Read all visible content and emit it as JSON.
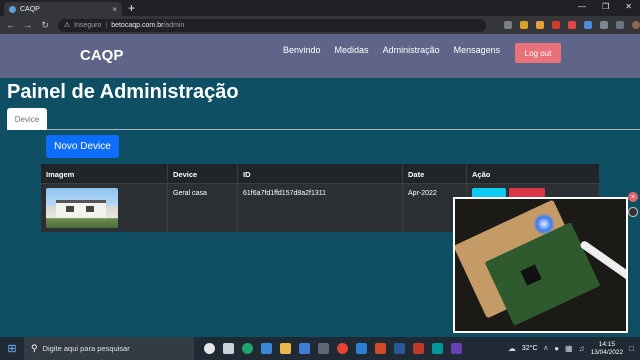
{
  "browser": {
    "tab_title": "CAQP",
    "tab_close": "×",
    "new_tab": "+",
    "win_min": "—",
    "win_restore": "❐",
    "win_close": "✕",
    "security_label": "Inseguro",
    "url_host": "betocaqp.com.br",
    "url_path": "/admin"
  },
  "navbar": {
    "brand": "CAQP",
    "links": [
      "Benvindo",
      "Medidas",
      "Administração",
      "Mensagens"
    ],
    "logout_label": "Log out"
  },
  "page": {
    "title": "Painel de Administração",
    "tab_label": "Device",
    "new_button": "Novo Device"
  },
  "table": {
    "headers": [
      "Imagem",
      "Device",
      "ID",
      "Date",
      "Ação"
    ],
    "rows": [
      {
        "device": "Geral casa",
        "id": "61f6a7fd1ffd157d8a2f1311",
        "date": "Apr-2022"
      }
    ]
  },
  "taskbar": {
    "search_placeholder": "Digite aqui para pesquisar",
    "temperature": "32°C",
    "time": "14:15",
    "date": "13/04/2022"
  },
  "colors": {
    "page_bg": "#0f4f63",
    "navbar_bg": "#5e6588",
    "logout_bg": "#e8717a",
    "primary": "#0d6efd",
    "table_header": "#212529",
    "table_row": "#2c3034",
    "edit": "#0dcaf0",
    "delete": "#dc3545"
  }
}
